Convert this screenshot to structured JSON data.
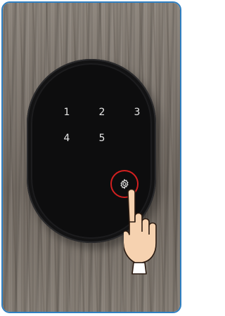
{
  "keypad": {
    "keys": [
      "1",
      "2",
      "3",
      "4",
      "5"
    ]
  },
  "settings_button": {
    "icon": "gear-icon",
    "highlight_color": "#d32020"
  },
  "hand": {
    "icon": "pointing-hand-icon",
    "skin_color": "#f6d2b0"
  },
  "frame_border_color": "#2f7fc1"
}
